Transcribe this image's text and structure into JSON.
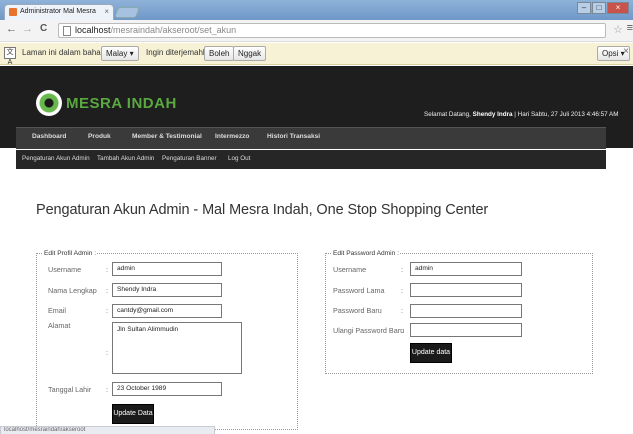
{
  "browser": {
    "tab_title": "Administrator Mal Mesra",
    "tab_close": "×",
    "url_host": "localhost",
    "url_path": "/mesraindah/akseroot/set_akun",
    "nav": {
      "back": "←",
      "forward": "→",
      "reload": "C"
    }
  },
  "translate_bar": {
    "prefix": "Laman ini dalam bahasa",
    "language": "Malay ▾",
    "question": "Ingin diterjemahkan?",
    "yes": "Boleh",
    "no": "Nggak",
    "options": "Opsi ▾",
    "close": "×"
  },
  "header": {
    "logo_text": "MESRA INDAH",
    "welcome_prefix": "Selamat Datang, ",
    "welcome_user": "Shendy Indra",
    "welcome_suffix": " | Hari Sabtu, 27 Juli 2013 4:46:57 AM"
  },
  "main_nav": [
    "Dashboard",
    "Produk",
    "Member & Testimonial",
    "Intermezzo",
    "Histori Transaksi"
  ],
  "sub_nav": [
    "Pengaturan Akun Admin",
    "Tambah Akun Admin",
    "Pengaturan Banner",
    "Log Out"
  ],
  "page_title": "Pengaturan Akun Admin - Mal Mesra Indah, One Stop Shopping Center",
  "profile_form": {
    "legend": "Edit Profil Admin :",
    "username_label": "Username",
    "username_value": "admin",
    "fullname_label": "Nama Lengkap",
    "fullname_value": "Shendy Indra",
    "email_label": "Email",
    "email_value": "cantdy@gmail.com",
    "address_label": "Alamat",
    "address_value": "Jln Sultan Alimmudin",
    "birthdate_label": "Tanggal Lahir",
    "birthdate_value": "23 October 1989",
    "submit": "Update Data"
  },
  "password_form": {
    "legend": "Edit Password Admin :",
    "username_label": "Username",
    "username_value": "admin",
    "old_label": "Password Lama",
    "new_label": "Password Baru",
    "repeat_label": "Ulangi Password Baru",
    "submit": "Update data"
  },
  "status_bar": "localhost/mesraindah/akseroot"
}
